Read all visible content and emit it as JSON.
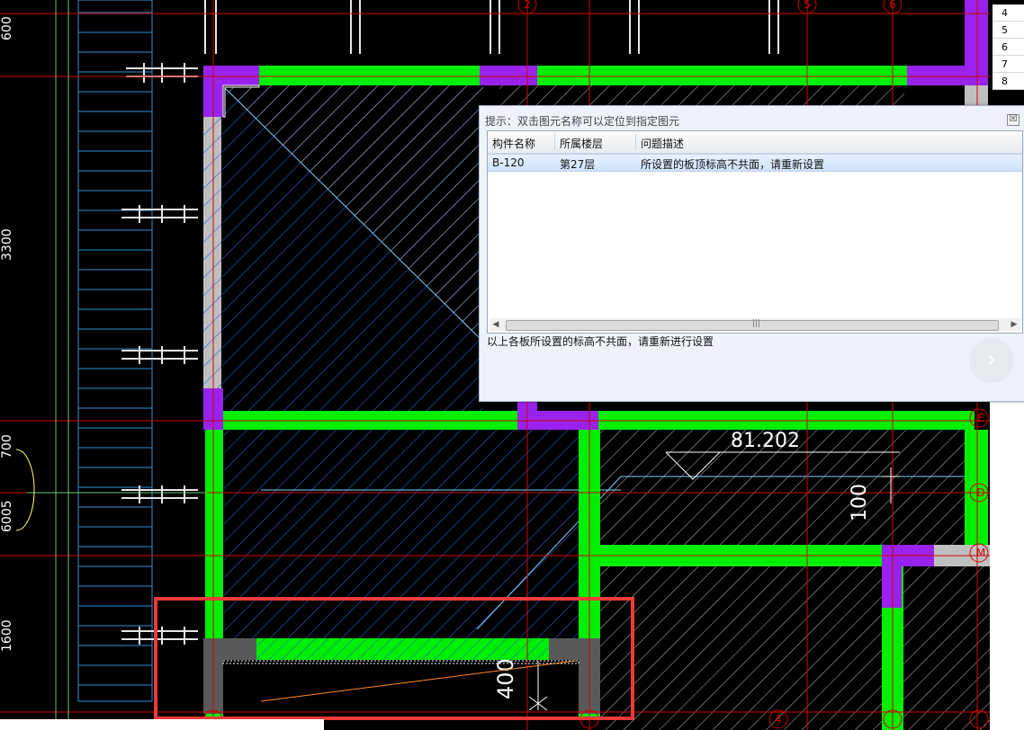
{
  "cad": {
    "dims": {
      "d600": "600",
      "d3300": "3300",
      "d700": "700",
      "d6005": "6005",
      "d1600": "1600",
      "d81202": "81.202",
      "d100": "100",
      "d400": "400"
    },
    "grid_bubbles": [
      "2",
      "5",
      "6",
      "C",
      "D",
      "E",
      "F",
      "4",
      "M"
    ]
  },
  "row_numbers": [
    "4",
    "5",
    "6",
    "7",
    "8"
  ],
  "dialog": {
    "title": "提示：双击图元名称可以定位到指定图元",
    "close_label": "☒",
    "columns": [
      "构件名称",
      "所属楼层",
      "问题描述"
    ],
    "rows": [
      {
        "name": "B-120",
        "floor": "第27层",
        "desc": "所设置的板顶标高不共面，请重新设置"
      }
    ],
    "message": "以上各板所设置的标高不共面，请重新进行设置",
    "next_label": "›"
  },
  "colors": {
    "wall_green": "#00ee00",
    "column_purple": "#9922ee",
    "highlight_red": "#ee3a3a",
    "grid_red": "#d40000",
    "hatch_blue": "#2a5fd6",
    "hatch_white": "#c8c8c8"
  }
}
